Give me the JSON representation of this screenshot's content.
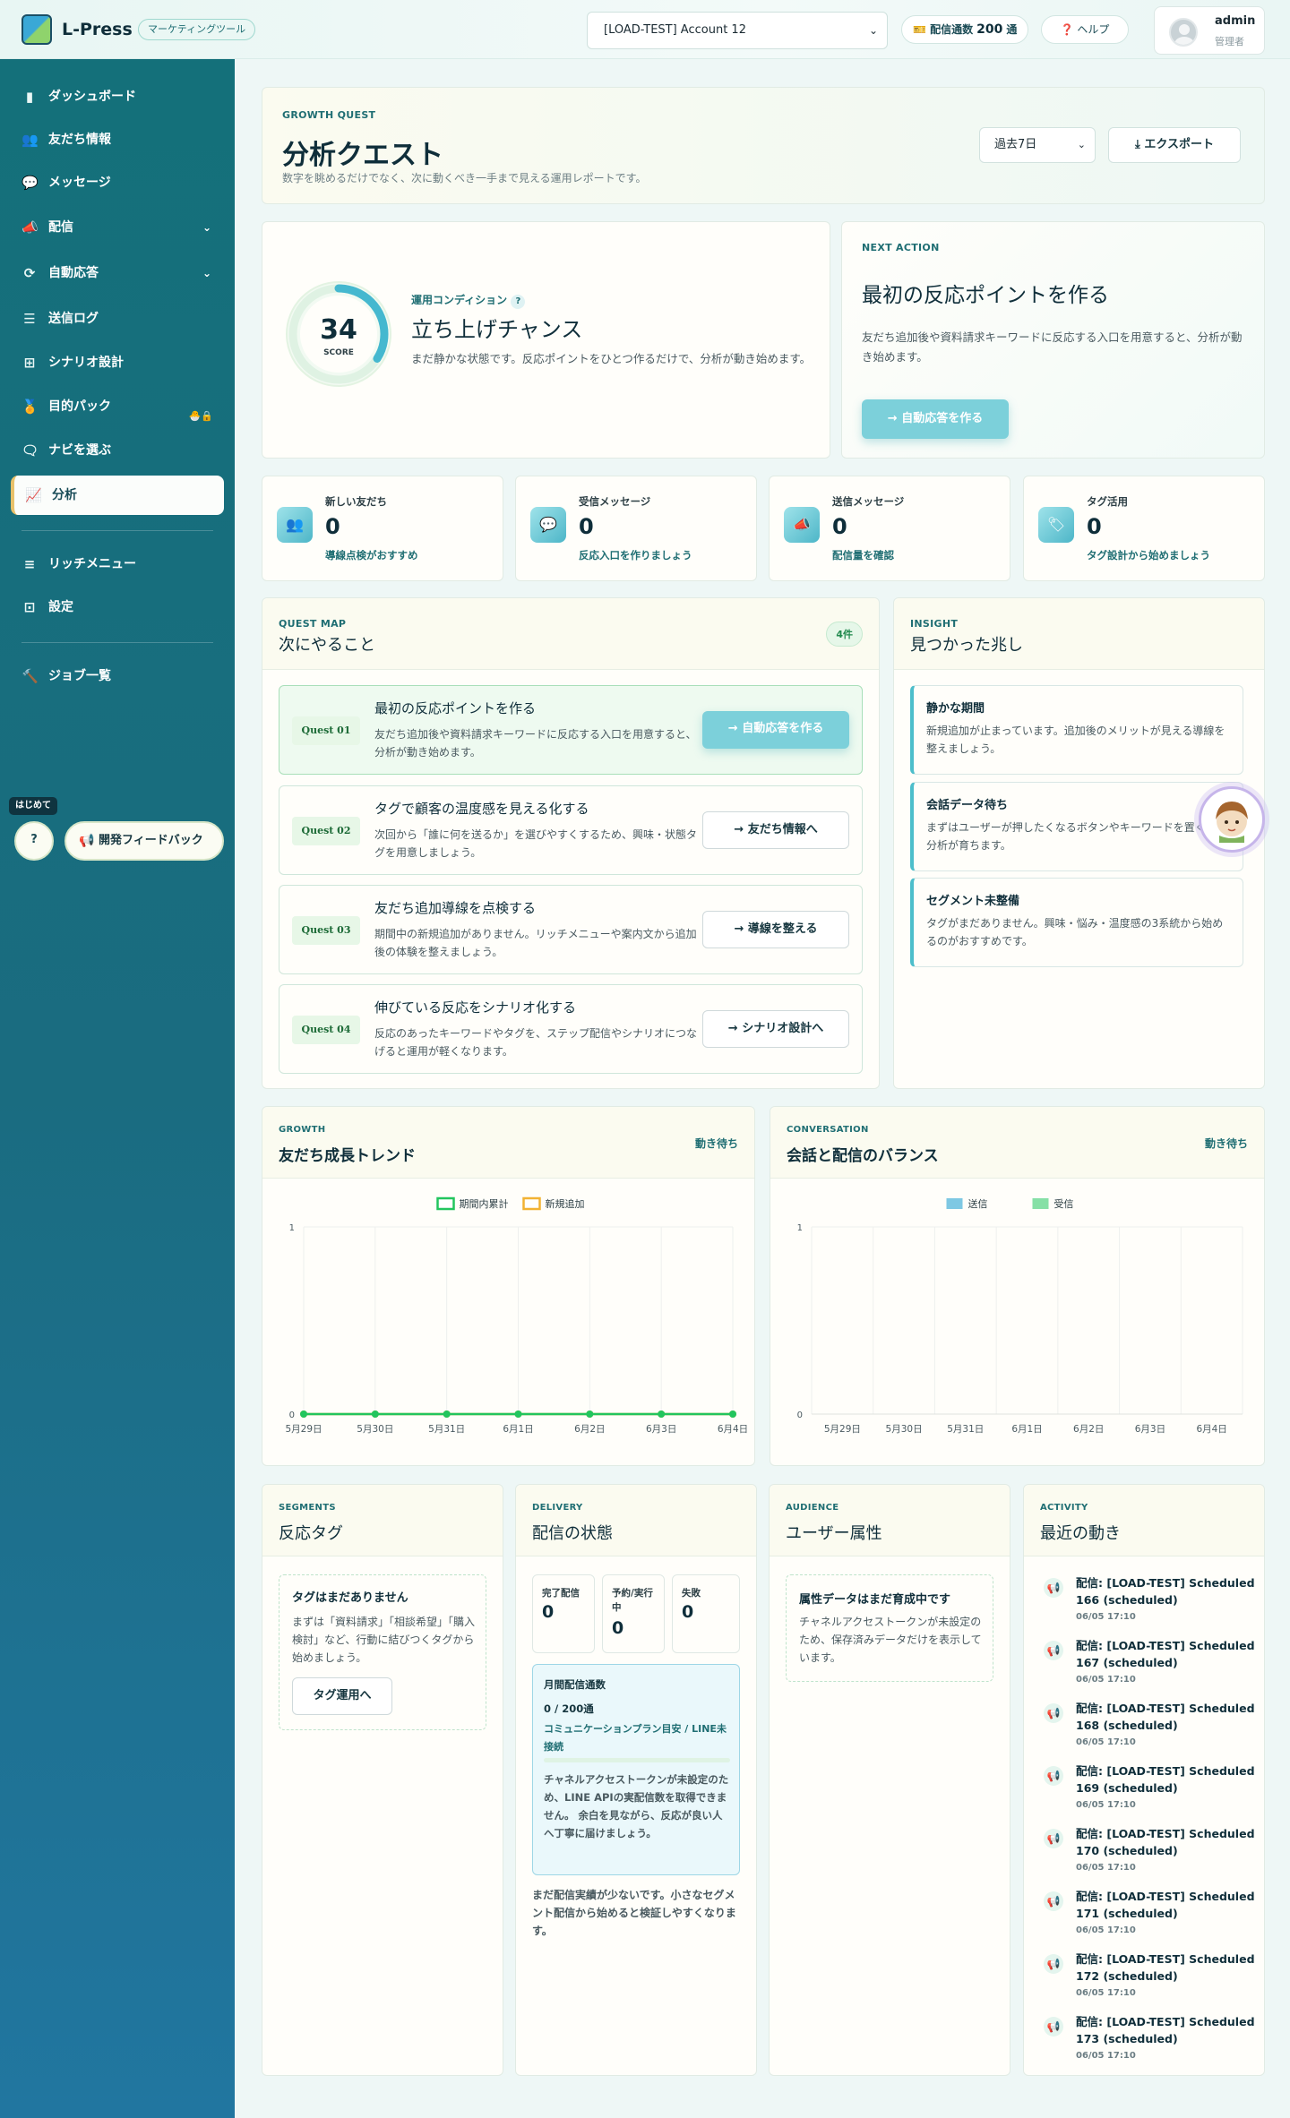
{
  "header": {
    "brand": "L-Press",
    "brand_tag": "マーケティングツール",
    "account": "[LOAD-TEST] Account 12",
    "quota_label": "配信通数",
    "quota_value": "200",
    "quota_unit": "通",
    "help": "ヘルプ",
    "user_name": "admin",
    "user_role": "管理者"
  },
  "sidebar": {
    "items": [
      {
        "label": "ダッシュボード"
      },
      {
        "label": "友だち情報"
      },
      {
        "label": "メッセージ"
      },
      {
        "label": "配信"
      },
      {
        "label": "自動応答"
      },
      {
        "label": "送信ログ"
      },
      {
        "label": "シナリオ設計"
      },
      {
        "label": "目的パック"
      },
      {
        "label": "ナビを選ぶ"
      },
      {
        "label": "分析"
      },
      {
        "label": "リッチメニュー"
      },
      {
        "label": "設定"
      },
      {
        "label": "ジョブ一覧"
      }
    ],
    "hajime": "はじめて",
    "feedback": "開発フィードバック"
  },
  "hero": {
    "eyebrow": "GROWTH QUEST",
    "title": "分析クエスト",
    "subtitle": "数字を眺めるだけでなく、次に動くべき一手まで見える運用レポートです。",
    "period": "過去7日",
    "export": "エクスポート"
  },
  "condition": {
    "score": "34",
    "score_label": "SCORE",
    "score_value": 34,
    "label": "運用コンディション",
    "title": "立ち上げチャンス",
    "desc": "まだ静かな状態です。反応ポイントをひとつ作るだけで、分析が動き始めます。"
  },
  "next_action": {
    "eyebrow": "NEXT ACTION",
    "title": "最初の反応ポイントを作る",
    "desc": "友だち追加後や資料請求キーワードに反応する入口を用意すると、分析が動き始めます。",
    "button": "自動応答を作る"
  },
  "stats": [
    {
      "label": "新しい友だち",
      "value": "0",
      "hint": "導線点検がおすすめ"
    },
    {
      "label": "受信メッセージ",
      "value": "0",
      "hint": "反応入口を作りましょう"
    },
    {
      "label": "送信メッセージ",
      "value": "0",
      "hint": "配信量を確認"
    },
    {
      "label": "タグ活用",
      "value": "0",
      "hint": "タグ設計から始めましょう"
    }
  ],
  "quest_map": {
    "eyebrow": "QUEST MAP",
    "title": "次にやること",
    "count": "4件",
    "quests": [
      {
        "tag": "Quest 01",
        "title": "最初の反応ポイントを作る",
        "desc": "友だち追加後や資料請求キーワードに反応する入口を用意すると、分析が動き始めます。",
        "button": "自動応答を作る"
      },
      {
        "tag": "Quest 02",
        "title": "タグで顧客の温度感を見える化する",
        "desc": "次回から「誰に何を送るか」を選びやすくするため、興味・状態タグを用意しましょう。",
        "button": "友だち情報へ"
      },
      {
        "tag": "Quest 03",
        "title": "友だち追加導線を点検する",
        "desc": "期間中の新規追加がありません。リッチメニューや案内文から追加後の体験を整えましょう。",
        "button": "導線を整える"
      },
      {
        "tag": "Quest 04",
        "title": "伸びている反応をシナリオ化する",
        "desc": "反応のあったキーワードやタグを、ステップ配信やシナリオにつなげると運用が軽くなります。",
        "button": "シナリオ設計へ"
      }
    ]
  },
  "insight": {
    "eyebrow": "INSIGHT",
    "title": "見つかった兆し",
    "items": [
      {
        "title": "静かな期間",
        "desc": "新規追加が止まっています。追加後のメリットが見える導線を整えましょう。"
      },
      {
        "title": "会話データ待ち",
        "desc": "まずはユーザーが押したくなるボタンやキーワードを置くと、分析が育ちます。"
      },
      {
        "title": "セグメント未整備",
        "desc": "タグがまだありません。興味・悩み・温度感の3系統から始めるのがおすすめです。"
      }
    ]
  },
  "growth": {
    "eyebrow": "GROWTH",
    "title": "友だち成長トレンド",
    "status": "動き待ち"
  },
  "conversation": {
    "eyebrow": "CONVERSATION",
    "title": "会話と配信のバランス",
    "status": "動き待ち"
  },
  "chart_data": [
    {
      "type": "line",
      "categories": [
        "5月29日",
        "5月30日",
        "5月31日",
        "6月1日",
        "6月2日",
        "6月3日",
        "6月4日"
      ],
      "series": [
        {
          "name": "期間内累計",
          "values": [
            0,
            0,
            0,
            0,
            0,
            0,
            0
          ],
          "color": "#22c55e"
        },
        {
          "name": "新規追加",
          "values": [
            0,
            0,
            0,
            0,
            0,
            0,
            0
          ],
          "color": "#f2b233"
        }
      ],
      "ylim": [
        0,
        1
      ],
      "yticks": [
        "0",
        "1"
      ],
      "legend": "top-center",
      "grid": true
    },
    {
      "type": "bar",
      "categories": [
        "5月29日",
        "5月30日",
        "5月31日",
        "6月1日",
        "6月2日",
        "6月3日",
        "6月4日"
      ],
      "series": [
        {
          "name": "送信",
          "values": [
            0,
            0,
            0,
            0,
            0,
            0,
            0
          ],
          "color": "#7ec8e3"
        },
        {
          "name": "受信",
          "values": [
            0,
            0,
            0,
            0,
            0,
            0,
            0
          ],
          "color": "#86e0a6"
        }
      ],
      "ylim": [
        0,
        1
      ],
      "yticks": [
        "0",
        "1"
      ],
      "legend": "top-center",
      "grid": true
    }
  ],
  "segments": {
    "eyebrow": "SEGMENTS",
    "title": "反応タグ",
    "empty_title": "タグはまだありません",
    "empty_desc": "まずは「資料請求」「相談希望」「購入検討」など、行動に結びつくタグから始めましょう。",
    "button": "タグ運用へ"
  },
  "delivery": {
    "eyebrow": "DELIVERY",
    "title": "配信の状態",
    "stats": [
      {
        "label": "完了配信",
        "value": "0"
      },
      {
        "label": "予約/実行中",
        "value": "0"
      },
      {
        "label": "失敗",
        "value": "0"
      }
    ],
    "quota_title": "月間配信通数",
    "quota_value": "0 / 200通",
    "quota_plan": "コミュニケーションプラン目安 / LINE未接続",
    "quota_note": "チャネルアクセストークンが未設定のため、LINE APIの実配信数を取得できません。 余白を見ながら、反応が良い人へ丁寧に届けましょう。",
    "footer": "まだ配信実績が少ないです。小さなセグメント配信から始めると検証しやすくなります。"
  },
  "audience": {
    "eyebrow": "AUDIENCE",
    "title": "ユーザー属性",
    "empty_title": "属性データはまだ育成中です",
    "empty_desc": "チャネルアクセストークンが未設定のため、保存済みデータだけを表示しています。"
  },
  "activity": {
    "eyebrow": "ACTIVITY",
    "title": "最近の動き",
    "items": [
      {
        "title": "配信: [LOAD-TEST] Scheduled 166 (scheduled)",
        "date": "06/05 17:10"
      },
      {
        "title": "配信: [LOAD-TEST] Scheduled 167 (scheduled)",
        "date": "06/05 17:10"
      },
      {
        "title": "配信: [LOAD-TEST] Scheduled 168 (scheduled)",
        "date": "06/05 17:10"
      },
      {
        "title": "配信: [LOAD-TEST] Scheduled 169 (scheduled)",
        "date": "06/05 17:10"
      },
      {
        "title": "配信: [LOAD-TEST] Scheduled 170 (scheduled)",
        "date": "06/05 17:10"
      },
      {
        "title": "配信: [LOAD-TEST] Scheduled 171 (scheduled)",
        "date": "06/05 17:10"
      },
      {
        "title": "配信: [LOAD-TEST] Scheduled 172 (scheduled)",
        "date": "06/05 17:10"
      },
      {
        "title": "配信: [LOAD-TEST] Scheduled 173 (scheduled)",
        "date": "06/05 17:10"
      }
    ]
  },
  "icons": {
    "dashboard": "bar-chart-icon",
    "friends": "people-icon",
    "messages": "chat-icon",
    "broadcast": "megaphone-icon",
    "autoreply": "refresh-icon",
    "log": "list-icon",
    "scenario": "sitemap-icon",
    "pack": "award-icon",
    "navi": "speech-icon",
    "analytics": "analytics-icon"
  }
}
